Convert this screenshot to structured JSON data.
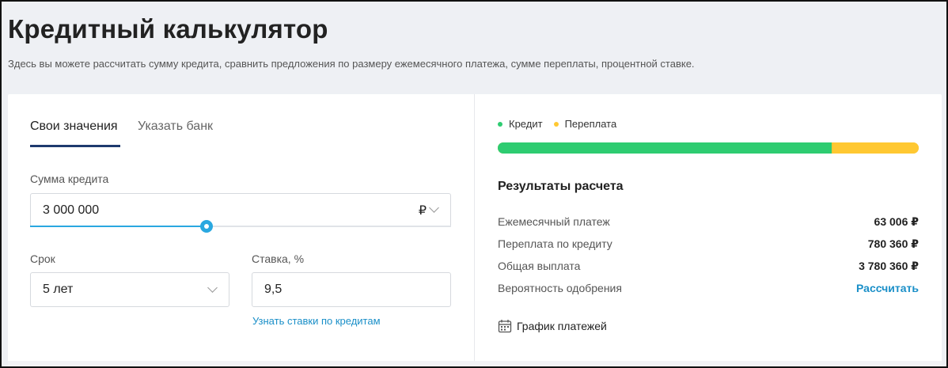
{
  "page": {
    "title": "Кредитный калькулятор",
    "subtitle": "Здесь вы можете рассчитать сумму кредита, сравнить предложения по размеру ежемесячного платежа, сумме переплаты, процентной ставке."
  },
  "tabs": [
    {
      "label": "Свои значения",
      "active": true
    },
    {
      "label": "Указать банк",
      "active": false
    }
  ],
  "form": {
    "amount": {
      "label": "Сумма кредита",
      "value": "3 000 000",
      "currency": "₽",
      "slider_fraction": 0.42
    },
    "term": {
      "label": "Срок",
      "value": "5 лет"
    },
    "rate": {
      "label": "Ставка, %",
      "value": "9,5",
      "link": "Узнать ставки по кредитам"
    }
  },
  "chart_legend": {
    "credit": {
      "label": "Кредит",
      "color": "#2ecc71"
    },
    "overpay": {
      "label": "Переплата",
      "color": "#ffc832"
    }
  },
  "bar": {
    "credit_fraction": 0.7936
  },
  "results": {
    "title": "Результаты расчета",
    "rows": [
      {
        "label": "Ежемесячный платеж",
        "value": "63 006 ₽"
      },
      {
        "label": "Переплата по кредиту",
        "value": "780 360 ₽"
      },
      {
        "label": "Общая выплата",
        "value": "3 780 360 ₽"
      },
      {
        "label": "Вероятность одобрения",
        "value": "Рассчитать"
      }
    ],
    "schedule_label": "График платежей"
  },
  "colors": {
    "accent_link": "#1a8fc8",
    "tab_underline": "#1e3a6e",
    "slider": "#2aa8e0"
  }
}
